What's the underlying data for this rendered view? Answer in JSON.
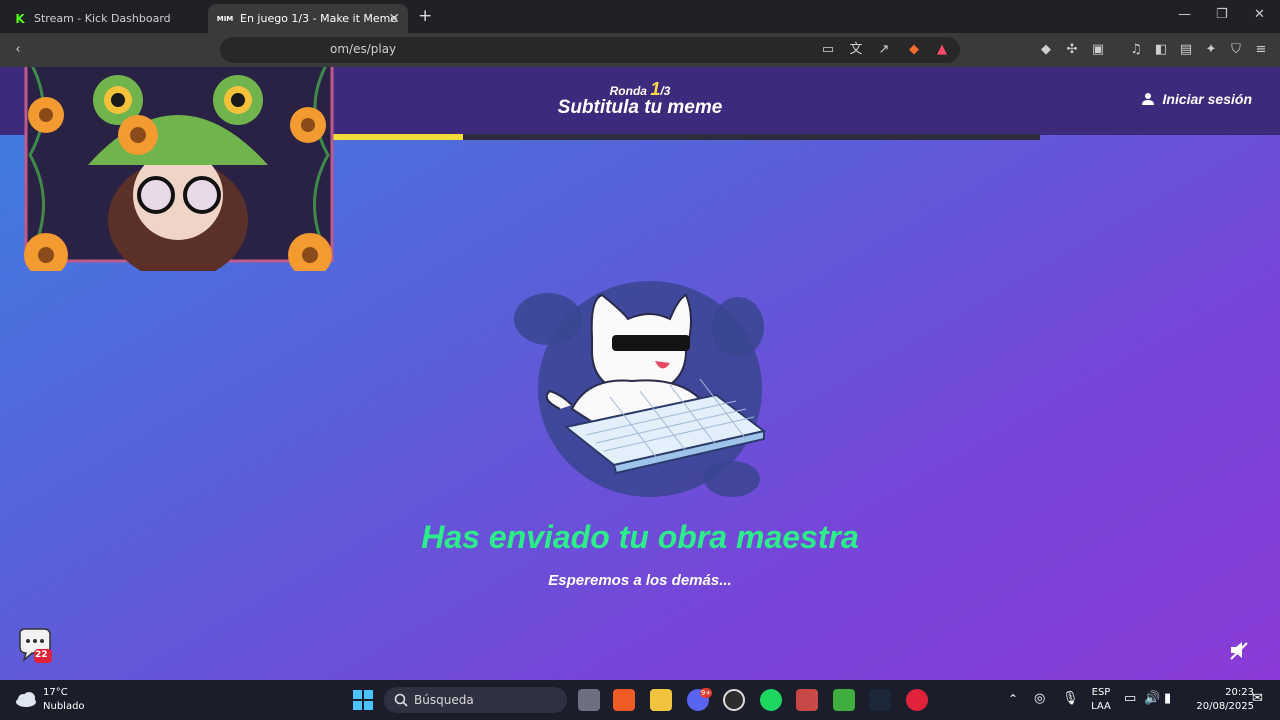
{
  "browser": {
    "tabs": [
      {
        "title": "Stream - Kick Dashboard",
        "active": false
      },
      {
        "title": "En juego 1/3 - Make it Meme",
        "active": true
      }
    ],
    "url_visible": "om/es/play"
  },
  "page": {
    "round_label": "Ronda",
    "round_current": "1",
    "round_total": "/3",
    "title": "Subtitula tu meme",
    "login_label": "Iniciar sesión",
    "round_progress": 0.27,
    "status_title": "Has enviado tu obra maestra",
    "status_subtitle": "Esperemos a los demás...",
    "chat_badge": "22",
    "colors": {
      "accent_green": "#2bf08a",
      "progress_yellow": "#f4dd3a",
      "header_purple": "#3e2a7c"
    }
  },
  "taskbar": {
    "weather_temp": "17°C",
    "weather_desc": "Nublado",
    "search_placeholder": "Búsqueda",
    "lang_top": "ESP",
    "lang_bottom": "LAA",
    "time": "20:23",
    "date": "20/08/2025",
    "discord_badge": "9+"
  }
}
